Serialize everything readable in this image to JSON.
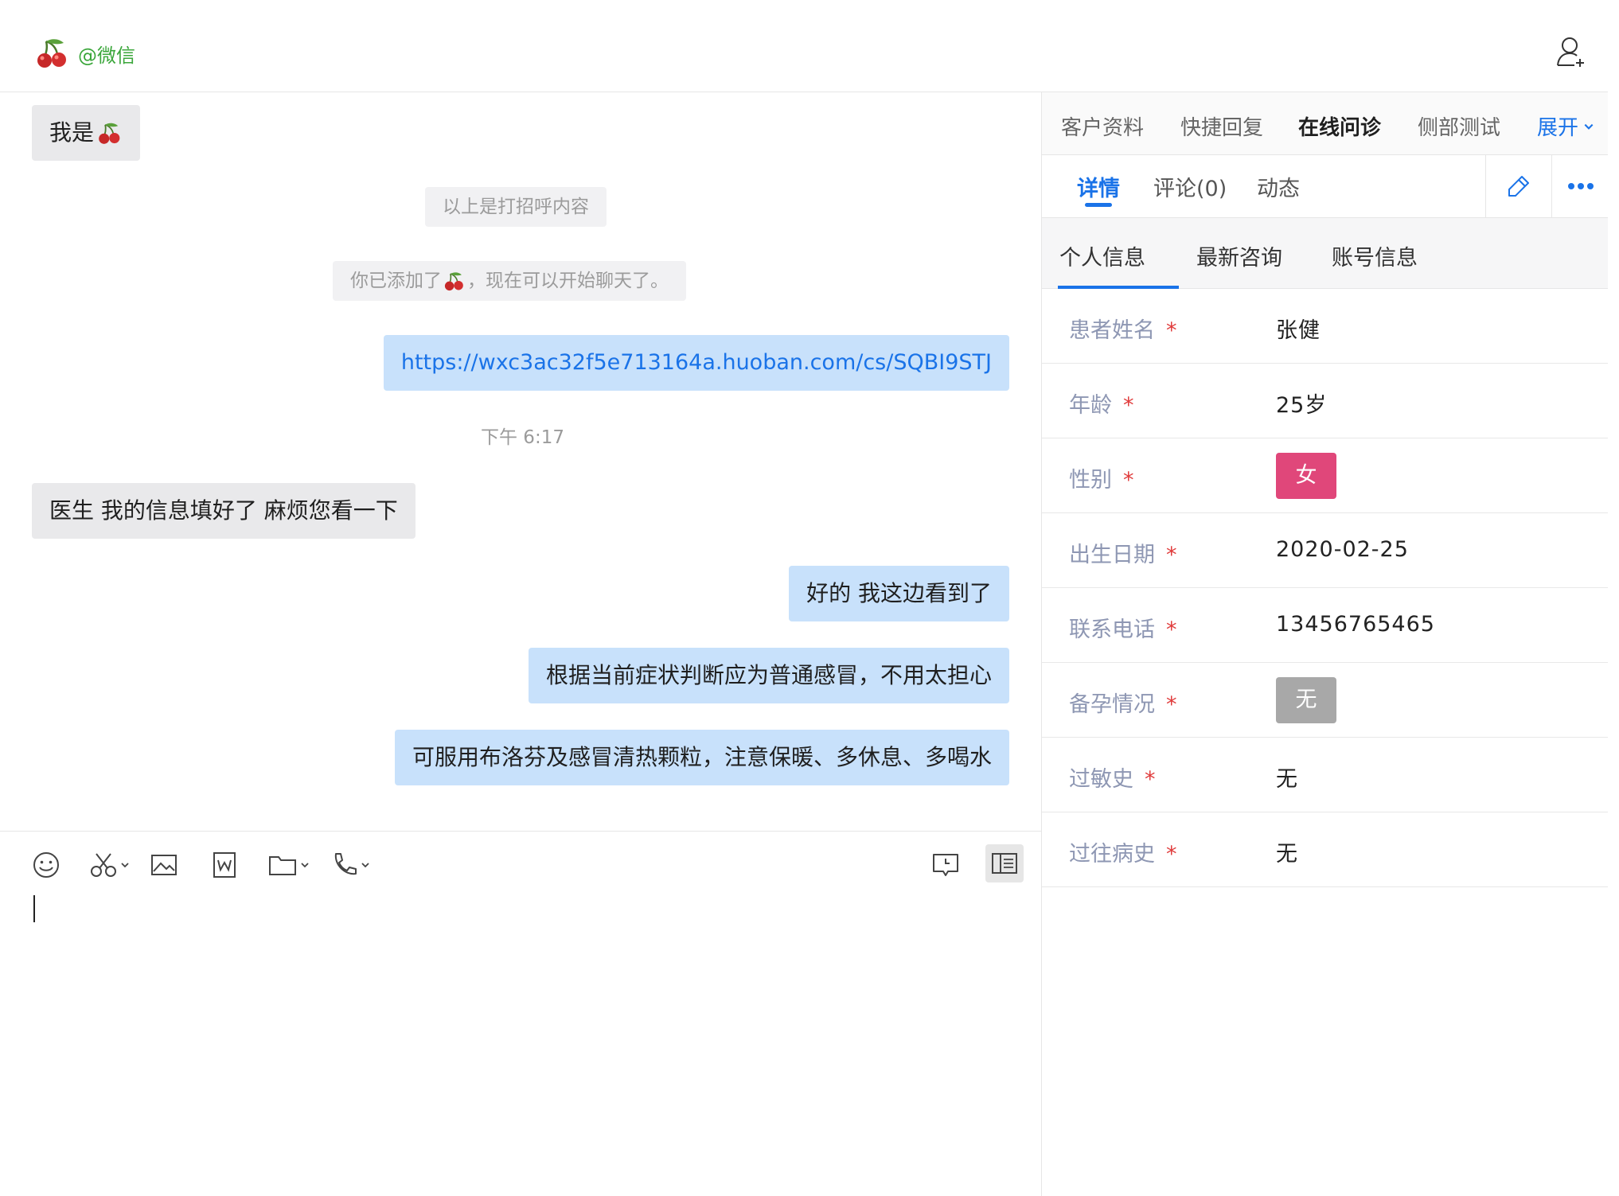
{
  "header": {
    "source_label": "@微信"
  },
  "chat": {
    "greeting": "我是",
    "sys_notice_greeting": "以上是打招呼内容",
    "sys_notice_added_prefix": "你已添加了",
    "sys_notice_added_suffix": "，现在可以开始聊天了。",
    "link_message": "https://wxc3ac32f5e713164a.huoban.com/cs/SQBI9STJ",
    "timestamp": "下午 6:17",
    "msg_patient": "医生  我的信息填好了 麻烦您看一下",
    "msg_reply_1": "好的 我这边看到了",
    "msg_reply_2": "根据当前症状判断应为普通感冒，不用太担心",
    "msg_reply_3": "可服用布洛芬及感冒清热颗粒，注意保暖、多休息、多喝水"
  },
  "composer": {
    "tools": [
      "emoji-icon",
      "scissors-icon",
      "image-icon",
      "word-doc-icon",
      "folder-icon",
      "phone-icon",
      "quick-reply-icon",
      "sidebar-toggle-icon"
    ]
  },
  "panel": {
    "top_tabs": [
      {
        "label": "客户资料"
      },
      {
        "label": "快捷回复"
      },
      {
        "label": "在线问诊"
      },
      {
        "label": "侧部测试"
      },
      {
        "label": "展开"
      }
    ],
    "sub_tabs": [
      {
        "label": "详情"
      },
      {
        "label": "评论(0)"
      },
      {
        "label": "动态"
      }
    ],
    "section_tabs": [
      {
        "label": "个人信息"
      },
      {
        "label": "最新咨询"
      },
      {
        "label": "账号信息"
      }
    ],
    "fields": [
      {
        "label": "患者姓名",
        "required": "*",
        "value": "张健"
      },
      {
        "label": "年龄",
        "required": "*",
        "value": "25岁"
      },
      {
        "label": "性别",
        "required": "*",
        "value": "女"
      },
      {
        "label": "出生日期",
        "required": "*",
        "value": "2020-02-25"
      },
      {
        "label": "联系电话",
        "required": "*",
        "value": "13456765465"
      },
      {
        "label": "备孕情况",
        "required": "*",
        "value": "无"
      },
      {
        "label": "过敏史",
        "required": "*",
        "value": "无"
      },
      {
        "label": "过往病史",
        "required": "*",
        "value": "无"
      }
    ],
    "colors": {
      "accent": "#1a73e8",
      "female_chip": "#e0477a",
      "none_chip": "#a8a8a8"
    }
  }
}
